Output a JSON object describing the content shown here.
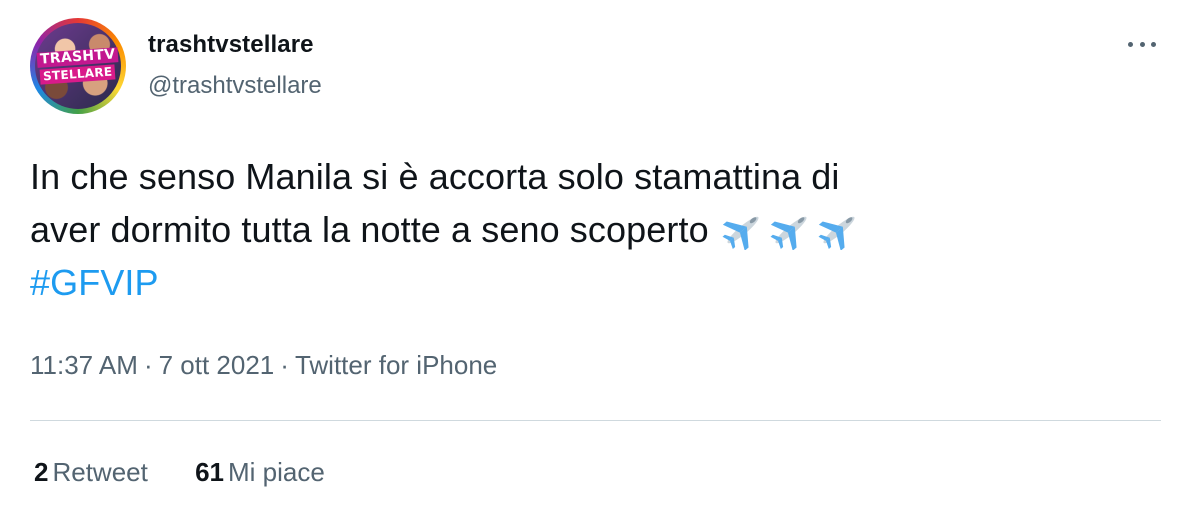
{
  "author": {
    "display_name": "trashtvstellare",
    "handle": "@trashtvstellare",
    "avatar_text_line1": "TRASHTV",
    "avatar_text_line2": "STELLARE"
  },
  "tweet": {
    "text_line1": "In che senso Manila si è accorta solo stamattina di",
    "text_line2": "aver dormito tutta la notte a seno scoperto",
    "emojis": [
      "airplane-icon",
      "airplane-icon",
      "airplane-icon"
    ],
    "hashtag": "#GFVIP"
  },
  "meta": {
    "time": "11:37 AM",
    "separator": "·",
    "date": "7 ott 2021",
    "source": "Twitter for iPhone"
  },
  "stats": {
    "retweet_count": "2",
    "retweet_label": "Retweet",
    "like_count": "61",
    "like_label": "Mi piace"
  },
  "colors": {
    "text": "#0f1419",
    "secondary": "#536471",
    "link": "#1d9bf0",
    "divider": "#cfd9de"
  }
}
